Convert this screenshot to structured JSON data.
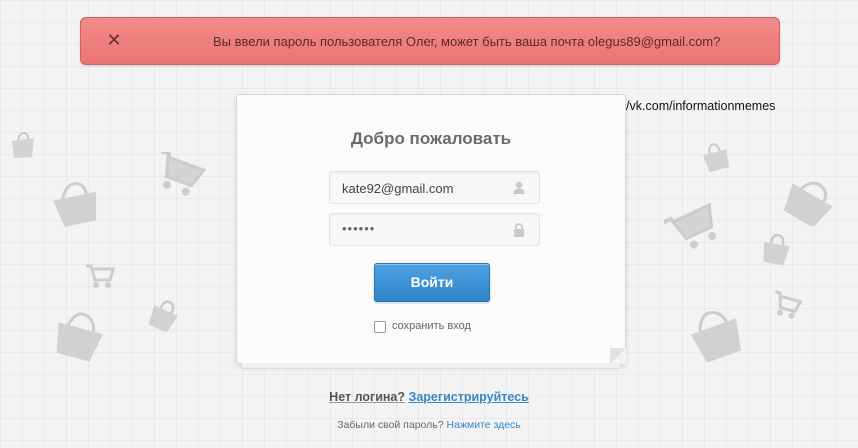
{
  "alert": {
    "close_glyph": "✕",
    "message": "Вы ввели пароль пользователя Олег, может быть ваша почта olegus89@gmail.com?",
    "color": "#ee7f7f"
  },
  "watermark": {
    "text": "https://vk.com/informationmemes"
  },
  "login": {
    "title": "Добро пожаловать",
    "email_value": "kate92@gmail.com",
    "password_value": "••••••",
    "email_icon": "user-icon",
    "password_icon": "lock-icon",
    "submit_label": "Войти",
    "submit_color": "#3b8fd4",
    "remember_label": "сохранить вход"
  },
  "footer": {
    "no_login_text": "Нет логина?",
    "register_link": "Зарегистрируйтесь",
    "forgot_text": "Забыли свой пароль?",
    "forgot_link": "Нажмите здесь"
  },
  "decorations": [
    "shopping-bag-icon",
    "shopping-cart-icon",
    "shopping-basket-icon"
  ]
}
